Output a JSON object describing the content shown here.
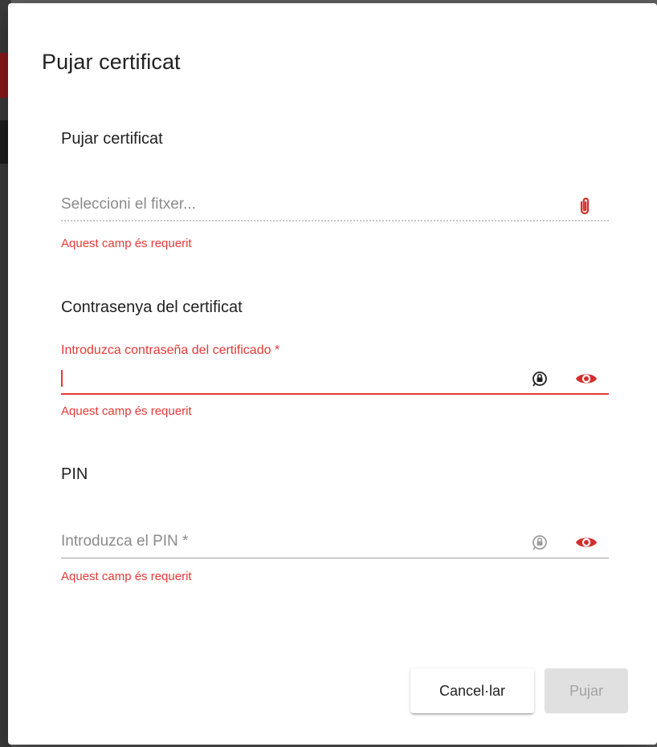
{
  "dialog": {
    "title": "Pujar certificat"
  },
  "upload_section": {
    "title": "Pujar certificat",
    "file_placeholder": "Seleccioni el fitxer...",
    "error": "Aquest camp és requerit"
  },
  "password_section": {
    "title": "Contrasenya del certificat",
    "label": "Introduzca contraseña del certificado *",
    "error": "Aquest camp és requerit"
  },
  "pin_section": {
    "title": "PIN",
    "placeholder": "Introduzca el PIN *",
    "error": "Aquest camp és requerit"
  },
  "actions": {
    "cancel_label": "Cancel·lar",
    "upload_label": "Pujar"
  },
  "colors": {
    "error": "#e53935",
    "accent_red": "#d32f2f"
  }
}
